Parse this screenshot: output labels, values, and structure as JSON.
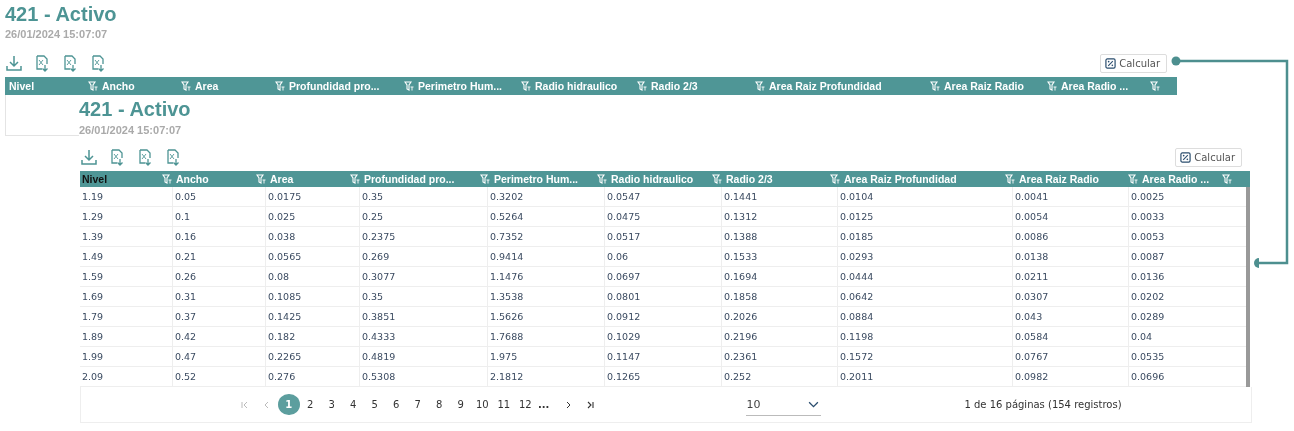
{
  "outer": {
    "title": "421 - Activo",
    "date": "26/01/2024 15:07:07",
    "calculate_button": "Calcular",
    "columns": [
      "Nivel",
      "Ancho",
      "Area",
      "Profundidad pro...",
      "Perimetro Hum...",
      "Radio hidraulico",
      "Radio 2/3",
      "Area Raiz Profundidad",
      "Area Raiz Radio",
      "Area Radio ...",
      ""
    ]
  },
  "inner": {
    "title": "421 - Activo",
    "date": "26/01/2024 15:07:07",
    "calculate_button": "Calcular",
    "columns": [
      "Nivel",
      "Ancho",
      "Area",
      "Profundidad pro...",
      "Perimetro Hum...",
      "Radio hidraulico",
      "Radio 2/3",
      "Area Raiz Profundidad",
      "Area Raiz Radio",
      "Area Radio ...",
      ""
    ],
    "rows": [
      [
        "1.19",
        "0.05",
        "0.0175",
        "0.35",
        "0.3202",
        "0.0547",
        "0.1441",
        "0.0104",
        "0.0041",
        "0.0025"
      ],
      [
        "1.29",
        "0.1",
        "0.025",
        "0.25",
        "0.5264",
        "0.0475",
        "0.1312",
        "0.0125",
        "0.0054",
        "0.0033"
      ],
      [
        "1.39",
        "0.16",
        "0.038",
        "0.2375",
        "0.7352",
        "0.0517",
        "0.1388",
        "0.0185",
        "0.0086",
        "0.0053"
      ],
      [
        "1.49",
        "0.21",
        "0.0565",
        "0.269",
        "0.9414",
        "0.06",
        "0.1533",
        "0.0293",
        "0.0138",
        "0.0087"
      ],
      [
        "1.59",
        "0.26",
        "0.08",
        "0.3077",
        "1.1476",
        "0.0697",
        "0.1694",
        "0.0444",
        "0.0211",
        "0.0136"
      ],
      [
        "1.69",
        "0.31",
        "0.1085",
        "0.35",
        "1.3538",
        "0.0801",
        "0.1858",
        "0.0642",
        "0.0307",
        "0.0202"
      ],
      [
        "1.79",
        "0.37",
        "0.1425",
        "0.3851",
        "1.5626",
        "0.0912",
        "0.2026",
        "0.0884",
        "0.043",
        "0.0289"
      ],
      [
        "1.89",
        "0.42",
        "0.182",
        "0.4333",
        "1.7688",
        "0.1029",
        "0.2196",
        "0.1198",
        "0.0584",
        "0.04"
      ],
      [
        "1.99",
        "0.47",
        "0.2265",
        "0.4819",
        "1.975",
        "0.1147",
        "0.2361",
        "0.1572",
        "0.0767",
        "0.0535"
      ],
      [
        "2.09",
        "0.52",
        "0.276",
        "0.5308",
        "2.1812",
        "0.1265",
        "0.252",
        "0.2011",
        "0.0982",
        "0.0696"
      ]
    ],
    "pagination": {
      "pages": [
        {
          "label": "1",
          "selected": true
        },
        {
          "label": "2",
          "selected": false
        },
        {
          "label": "3",
          "selected": false
        },
        {
          "label": "4",
          "selected": false
        },
        {
          "label": "5",
          "selected": false
        },
        {
          "label": "6",
          "selected": false
        },
        {
          "label": "7",
          "selected": false
        },
        {
          "label": "8",
          "selected": false
        },
        {
          "label": "9",
          "selected": false
        },
        {
          "label": "10",
          "selected": false
        },
        {
          "label": "11",
          "selected": false
        },
        {
          "label": "12",
          "selected": false
        }
      ],
      "ellipsis": "...",
      "page_size": "10",
      "summary": "1 de 16 páginas (154 registros)"
    }
  }
}
